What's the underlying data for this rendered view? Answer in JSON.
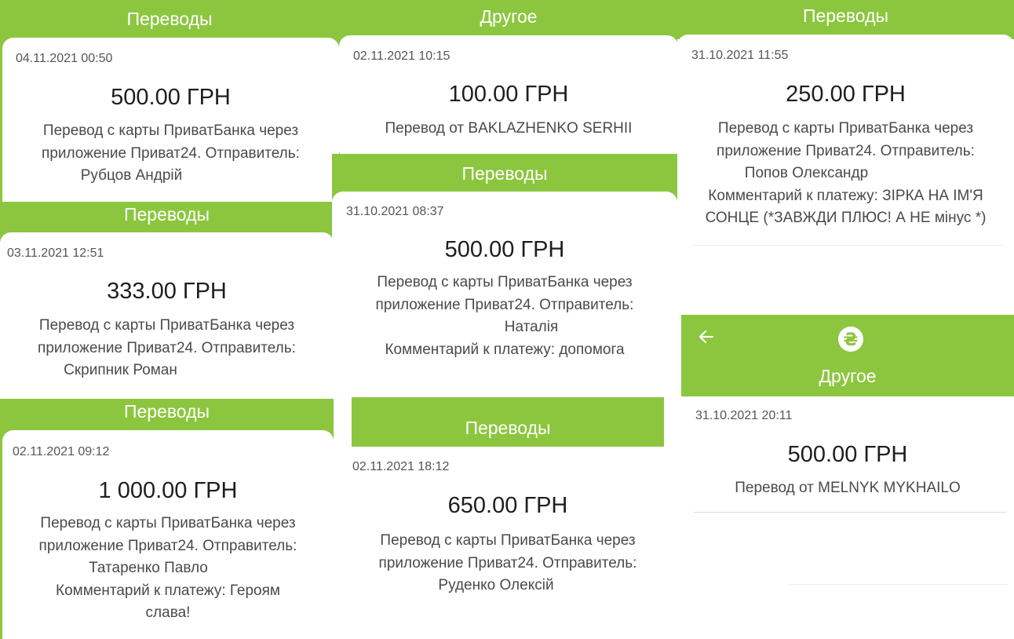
{
  "colors": {
    "header_green": "#8cc63f",
    "header_text": "#ffffff",
    "card_bg": "#ffffff"
  },
  "col1": {
    "p1": {
      "header": "Переводы",
      "date": "04.11.2021 00:50",
      "amount": "500.00 ГРН",
      "lines": [
        "Перевод с карты ПриватБанка через",
        "приложение Приват24. Отправитель:",
        "Рубцов Андрій"
      ]
    },
    "p2": {
      "header": "Переводы",
      "date": "03.11.2021 12:51",
      "amount": "333.00 ГРН",
      "lines": [
        "Перевод с карты ПриватБанка через",
        "приложение Приват24. Отправитель:",
        "Скрипник Роман"
      ]
    },
    "p3": {
      "header": "Переводы",
      "date": "02.11.2021 09:12",
      "amount": "1 000.00 ГРН",
      "lines": [
        "Перевод с карты ПриватБанка через",
        "приложение Приват24. Отправитель:",
        "Татаренко Павло",
        "Комментарий к платежу: Героям",
        "слава!"
      ]
    }
  },
  "col2": {
    "p1": {
      "header": "Другое",
      "date": "02.11.2021 10:15",
      "amount": "100.00 ГРН",
      "lines": [
        "Перевод от BAKLAZHENKO SERHII"
      ]
    },
    "p2": {
      "header": "Переводы",
      "date": "31.10.2021 08:37",
      "amount": "500.00 ГРН",
      "lines": [
        "Перевод с карты ПриватБанка через",
        "приложение Приват24. Отправитель:",
        "Наталія",
        "Комментарий к платежу: допомога"
      ]
    },
    "p3": {
      "header": "Переводы",
      "date": "02.11.2021 18:12",
      "amount": "650.00 ГРН",
      "lines": [
        "Перевод с карты ПриватБанка через",
        "приложение Приват24. Отправитель:",
        "Руденко Олексій"
      ]
    }
  },
  "col3": {
    "p1": {
      "header": "Переводы",
      "date": "31.10.2021 11:55",
      "amount": "250.00 ГРН",
      "lines": [
        "Перевод с карты ПриватБанка через",
        "приложение Приват24. Отправитель:",
        "Попов Олександр",
        "Комментарий к платежу: ЗІРКА НА ІМ'Я",
        "СОНЦЕ (*ЗАВЖДИ ПЛЮС! А НЕ мінус *)"
      ]
    },
    "p2": {
      "back_icon": "arrow-left-icon",
      "category_icon": "hryvnia-coin-icon",
      "header": "Другое",
      "date": "31.10.2021 20:11",
      "amount": "500.00 ГРН",
      "lines": [
        "Перевод от MELNYK MYKHAILO"
      ]
    }
  }
}
